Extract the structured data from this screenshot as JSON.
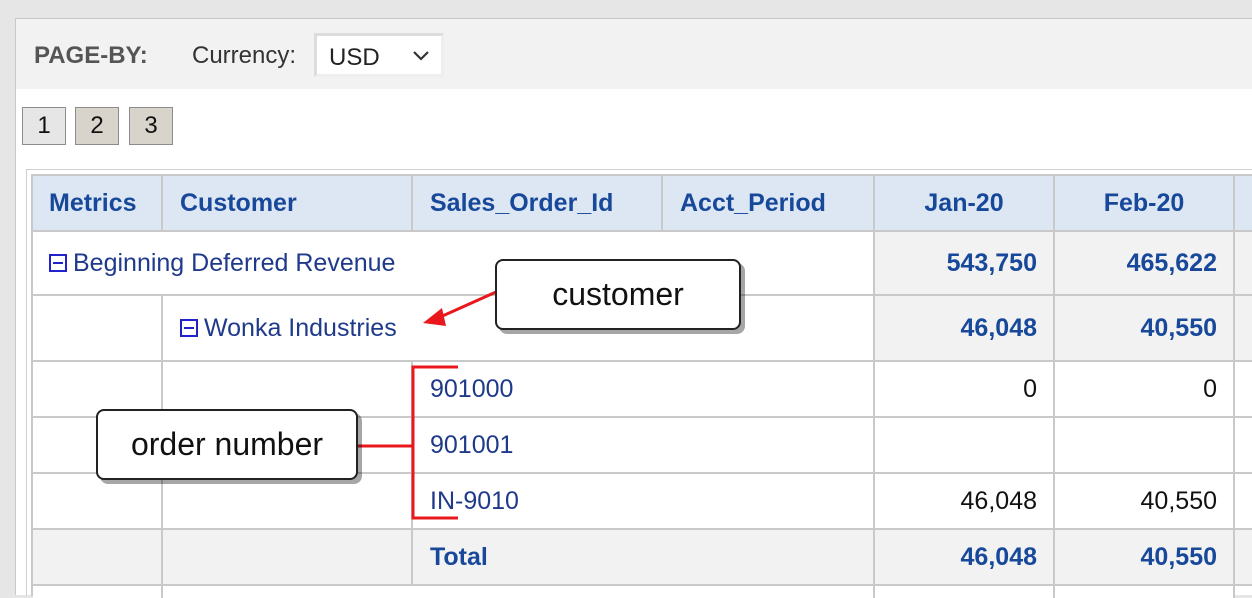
{
  "page_by": {
    "label": "PAGE-BY:",
    "currency_label": "Currency:",
    "currency_value": "USD"
  },
  "pages": [
    "1",
    "2",
    "3"
  ],
  "headers": [
    "Metrics",
    "Customer",
    "Sales_Order_Id",
    "Acct_Period",
    "Jan-20",
    "Feb-20"
  ],
  "rows": {
    "metric": {
      "label": "Beginning Deferred Revenue",
      "jan": "543,750",
      "feb": "465,622"
    },
    "customer": {
      "label": "Wonka Industries",
      "jan": "46,048",
      "feb": "40,550"
    },
    "orders": [
      {
        "id": "901000",
        "jan": "0",
        "feb": "0"
      },
      {
        "id": "901001",
        "jan": "",
        "feb": ""
      },
      {
        "id": "IN-9010",
        "jan": "46,048",
        "feb": "40,550"
      }
    ],
    "total": {
      "label": "Total",
      "jan": "46,048",
      "feb": "40,550"
    }
  },
  "annotations": {
    "customer": "customer",
    "order_number": "order number"
  },
  "colors": {
    "header_bg": "#dde7f3",
    "header_text": "#17489a",
    "annotation_line": "#e8181c"
  }
}
